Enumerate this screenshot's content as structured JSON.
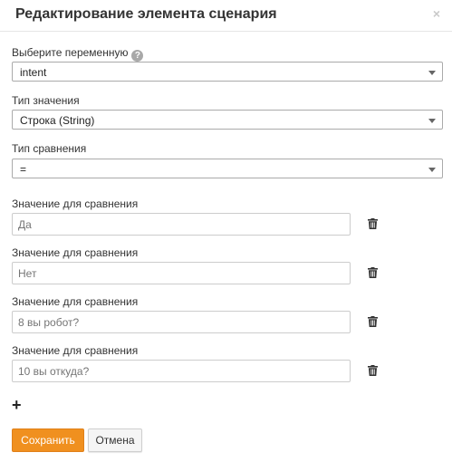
{
  "dialog": {
    "title": "Редактирование элемента сценария",
    "close_glyph": "×"
  },
  "variable": {
    "label": "Выберите переменную",
    "help_glyph": "?",
    "selected": "intent"
  },
  "value_type": {
    "label": "Тип значения",
    "selected": "Строка (String)"
  },
  "comparison_type": {
    "label": "Тип сравнения",
    "selected": "="
  },
  "comparison_values": [
    {
      "label": "Значение для сравнения",
      "placeholder": "Да"
    },
    {
      "label": "Значение для сравнения",
      "placeholder": "Нет"
    },
    {
      "label": "Значение для сравнения",
      "placeholder": "8 вы робот?"
    },
    {
      "label": "Значение для сравнения",
      "placeholder": "10 вы откуда?"
    }
  ],
  "add_glyph": "+",
  "buttons": {
    "save": "Сохранить",
    "cancel": "Отмена"
  },
  "colors": {
    "save_button": "#f0901f",
    "help_icon": "#a8a8a8"
  }
}
